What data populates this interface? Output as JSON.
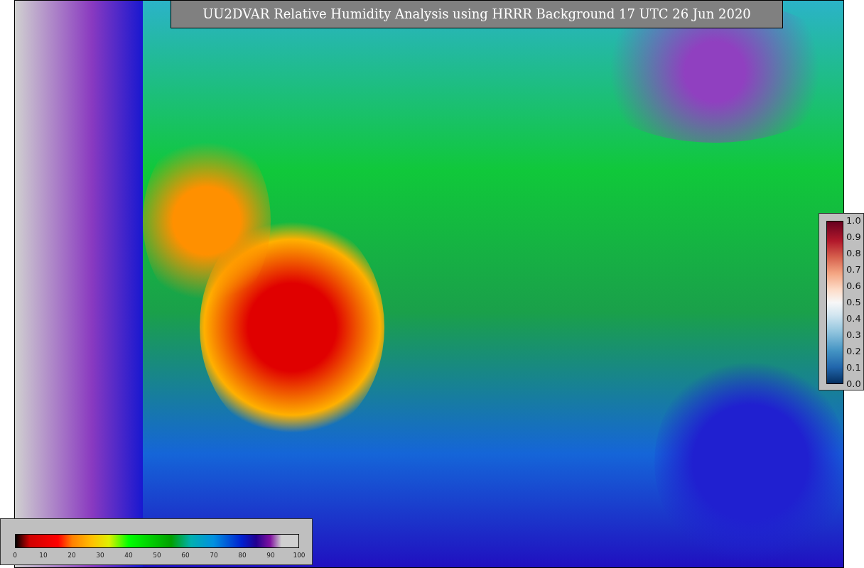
{
  "title": "UU2DVAR Relative Humidity Analysis using HRRR Background 17 UTC 26 Jun 2020",
  "humidity_colorbar": {
    "ticks": [
      "0",
      "10",
      "20",
      "30",
      "40",
      "50",
      "60",
      "70",
      "80",
      "90",
      "100"
    ]
  },
  "weight_colorbar": {
    "ticks": [
      "1.0",
      "0.9",
      "0.8",
      "0.7",
      "0.6",
      "0.5",
      "0.4",
      "0.3",
      "0.2",
      "0.1",
      "0.0"
    ]
  }
}
